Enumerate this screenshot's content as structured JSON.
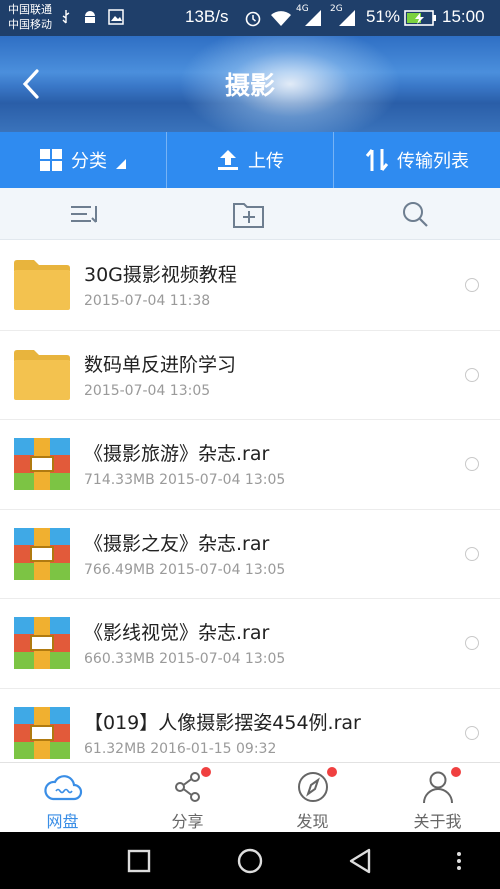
{
  "status_bar": {
    "carrier_1": "中国联通",
    "carrier_2": "中国移动",
    "net_speed": "13B/s",
    "signal_1_label": "4G",
    "signal_2_label": "2G",
    "battery": "51%",
    "time": "15:00"
  },
  "header": {
    "title": "摄影"
  },
  "toolbar": {
    "category_label": "分类",
    "upload_label": "上传",
    "transfer_label": "传输列表"
  },
  "files": [
    {
      "name": "30G摄影视频教程",
      "meta": "2015-07-04  11:38",
      "type": "folder"
    },
    {
      "name": "数码单反进阶学习",
      "meta": "2015-07-04  13:05",
      "type": "folder"
    },
    {
      "name": "《摄影旅游》杂志.rar",
      "meta": "714.33MB   2015-07-04  13:05",
      "type": "archive"
    },
    {
      "name": "《摄影之友》杂志.rar",
      "meta": "766.49MB   2015-07-04  13:05",
      "type": "archive"
    },
    {
      "name": "《影线视觉》杂志.rar",
      "meta": "660.33MB   2015-07-04  13:05",
      "type": "archive"
    },
    {
      "name": "【019】人像摄影摆姿454例.rar",
      "meta": "61.32MB   2016-01-15  09:32",
      "type": "archive"
    }
  ],
  "bottom_nav": {
    "tabs": [
      {
        "label": "网盘",
        "icon": "cloud-icon",
        "active": true,
        "badge": false
      },
      {
        "label": "分享",
        "icon": "share-icon",
        "active": false,
        "badge": true
      },
      {
        "label": "发现",
        "icon": "compass-icon",
        "active": false,
        "badge": true
      },
      {
        "label": "关于我",
        "icon": "person-icon",
        "active": false,
        "badge": true
      }
    ]
  },
  "colors": {
    "accent": "#2f8bf0",
    "status_bar": "#1f3f6a",
    "badge": "#f04040",
    "folder": "#f3c24f"
  }
}
